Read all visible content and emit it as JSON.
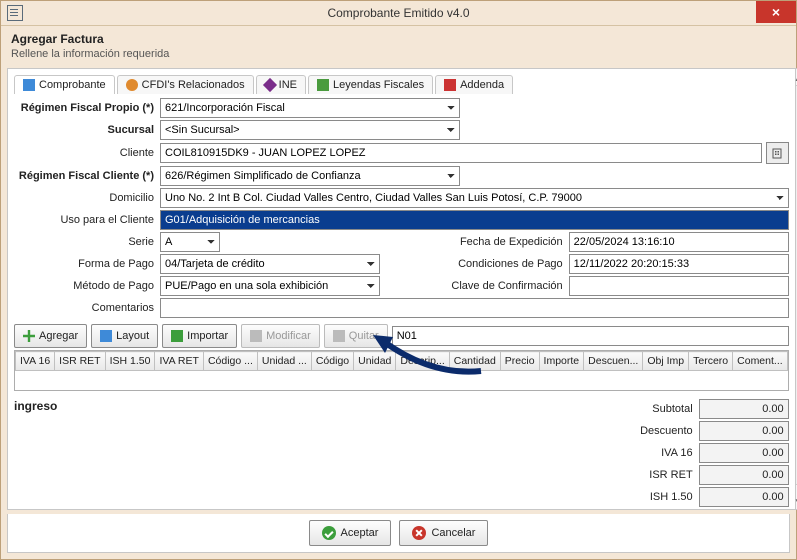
{
  "window": {
    "title": "Comprobante Emitido v4.0"
  },
  "header": {
    "title": "Agregar Factura",
    "subtitle": "Rellene la información requerida"
  },
  "tabs": [
    {
      "label": "Comprobante",
      "active": true
    },
    {
      "label": "CFDI's Relacionados"
    },
    {
      "label": "INE"
    },
    {
      "label": "Leyendas Fiscales"
    },
    {
      "label": "Addenda"
    }
  ],
  "form": {
    "regimen_propio": {
      "label": "Régimen Fiscal Propio (*)",
      "value": "621/Incorporación Fiscal"
    },
    "sucursal": {
      "label": "Sucursal",
      "value": "<Sin Sucursal>"
    },
    "cliente": {
      "label": "Cliente",
      "value": "COIL810915DK9 - JUAN LOPEZ LOPEZ"
    },
    "regimen_cliente": {
      "label": "Régimen Fiscal Cliente (*)",
      "value": "626/Régimen Simplificado de Confianza"
    },
    "domicilio": {
      "label": "Domicilio",
      "value": "Uno No. 2 Int B Col. Ciudad Valles Centro, Ciudad Valles San Luis Potosí, C.P. 79000"
    },
    "uso_cliente": {
      "label": "Uso para el Cliente",
      "value": "G01/Adquisición de mercancias"
    },
    "serie": {
      "label": "Serie",
      "value": "A"
    },
    "fecha_exp": {
      "label": "Fecha de Expedición",
      "value": "22/05/2024 13:16:10"
    },
    "forma_pago": {
      "label": "Forma de Pago",
      "value": "04/Tarjeta de crédito"
    },
    "cond_pago": {
      "label": "Condiciones de Pago",
      "value": "12/11/2022 20:20:15:33"
    },
    "metodo_pago": {
      "label": "Método de Pago",
      "value": "PUE/Pago en una sola exhibición"
    },
    "clave_conf": {
      "label": "Clave de Confirmación",
      "value": ""
    },
    "comentarios": {
      "label": "Comentarios",
      "value": ""
    }
  },
  "toolbar": {
    "agregar": "Agregar",
    "layout": "Layout",
    "importar": "Importar",
    "modificar": "Modificar",
    "quitar": "Quitar",
    "search": "N01"
  },
  "grid_cols": [
    "IVA 16",
    "ISR RET",
    "ISH 1.50",
    "IVA RET",
    "Código ...",
    "Unidad ...",
    "Código",
    "Unidad",
    "Descrip...",
    "Cantidad",
    "Precio",
    "Importe",
    "Descuen...",
    "Obj Imp",
    "Tercero",
    "Coment..."
  ],
  "type_label": "ingreso",
  "totals": [
    {
      "label": "Subtotal",
      "value": "0.00"
    },
    {
      "label": "Descuento",
      "value": "0.00"
    },
    {
      "label": "IVA 16",
      "value": "0.00"
    },
    {
      "label": "ISR RET",
      "value": "0.00"
    },
    {
      "label": "ISH 1.50",
      "value": "0.00"
    }
  ],
  "footer": {
    "aceptar": "Aceptar",
    "cancelar": "Cancelar"
  }
}
